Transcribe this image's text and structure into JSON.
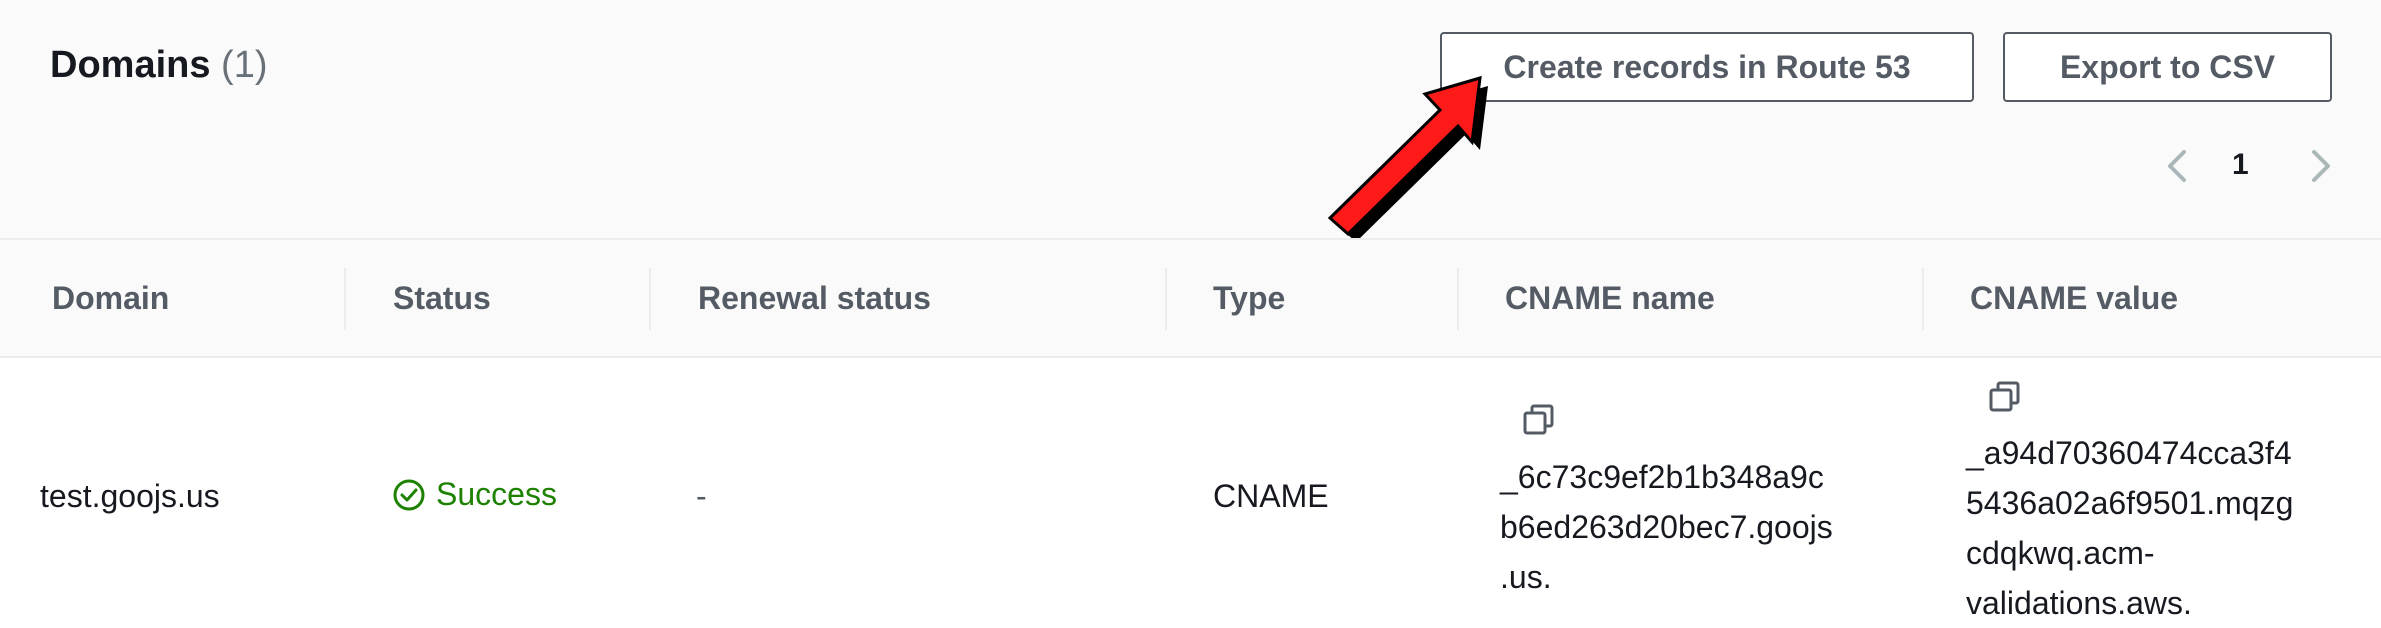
{
  "header": {
    "title": "Domains",
    "count": "(1)",
    "buttons": {
      "create_records": "Create records in Route 53",
      "export_csv": "Export to CSV"
    },
    "pagination": {
      "current_page": "1"
    }
  },
  "table": {
    "columns": [
      "Domain",
      "Status",
      "Renewal status",
      "Type",
      "CNAME name",
      "CNAME value"
    ],
    "rows": [
      {
        "domain": "test.goojs.us",
        "status": "Success",
        "renewal_status": "-",
        "type": "CNAME",
        "cname_name": "_6c73c9ef2b1b348a9c\nb6ed263d20bec7.goojs\n.us.",
        "cname_value": "_a94d70360474cca3f4\n5436a02a6f9501.mqzg\ncdqkwq.acm-\nvalidations.aws."
      }
    ]
  },
  "icons": {
    "status": "check-circle-icon",
    "copy": "copy-icon",
    "prev": "chevron-left-icon",
    "next": "chevron-right-icon",
    "annotation": "red-arrow-annotation"
  },
  "colors": {
    "success": "#1d8102",
    "header_bg": "#fafafa",
    "annotation_arrow": "#ff1a1a"
  }
}
